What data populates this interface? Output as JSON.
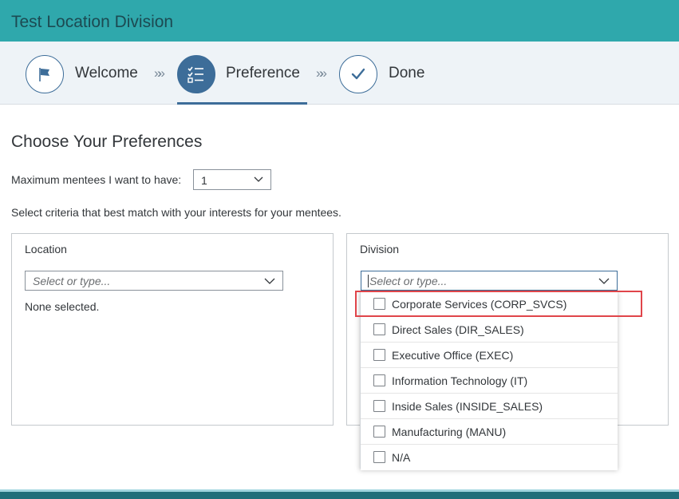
{
  "app": {
    "title": "Test Location Division"
  },
  "stepper": {
    "steps": [
      {
        "label": "Welcome",
        "icon": "flag-icon",
        "state": "completed"
      },
      {
        "label": "Preference",
        "icon": "checklist-icon",
        "state": "active"
      },
      {
        "label": "Done",
        "icon": "checkmark-icon",
        "state": "upcoming"
      }
    ],
    "separator": "»»"
  },
  "main": {
    "heading": "Choose Your Preferences",
    "max_mentees": {
      "label": "Maximum mentees I want to have:",
      "value": "1"
    },
    "criteria_text": "Select criteria that best match with your interests for your mentees."
  },
  "location_panel": {
    "title": "Location",
    "placeholder": "Select or type...",
    "selection_text": "None selected."
  },
  "division_panel": {
    "title": "Division",
    "placeholder": "Select or type...",
    "options": [
      {
        "label": "Corporate Services (CORP_SVCS)",
        "checked": false
      },
      {
        "label": "Direct Sales (DIR_SALES)",
        "checked": false
      },
      {
        "label": "Executive Office (EXEC)",
        "checked": false
      },
      {
        "label": "Information Technology (IT)",
        "checked": false
      },
      {
        "label": "Inside Sales (INSIDE_SALES)",
        "checked": false
      },
      {
        "label": "Manufacturing (MANU)",
        "checked": false
      },
      {
        "label": "N/A",
        "checked": false
      }
    ]
  },
  "colors": {
    "header_teal": "#2fa8ac",
    "step_accent": "#3d6d99",
    "highlight_red": "#e0454a",
    "footer_teal": "#1f6e7a"
  }
}
